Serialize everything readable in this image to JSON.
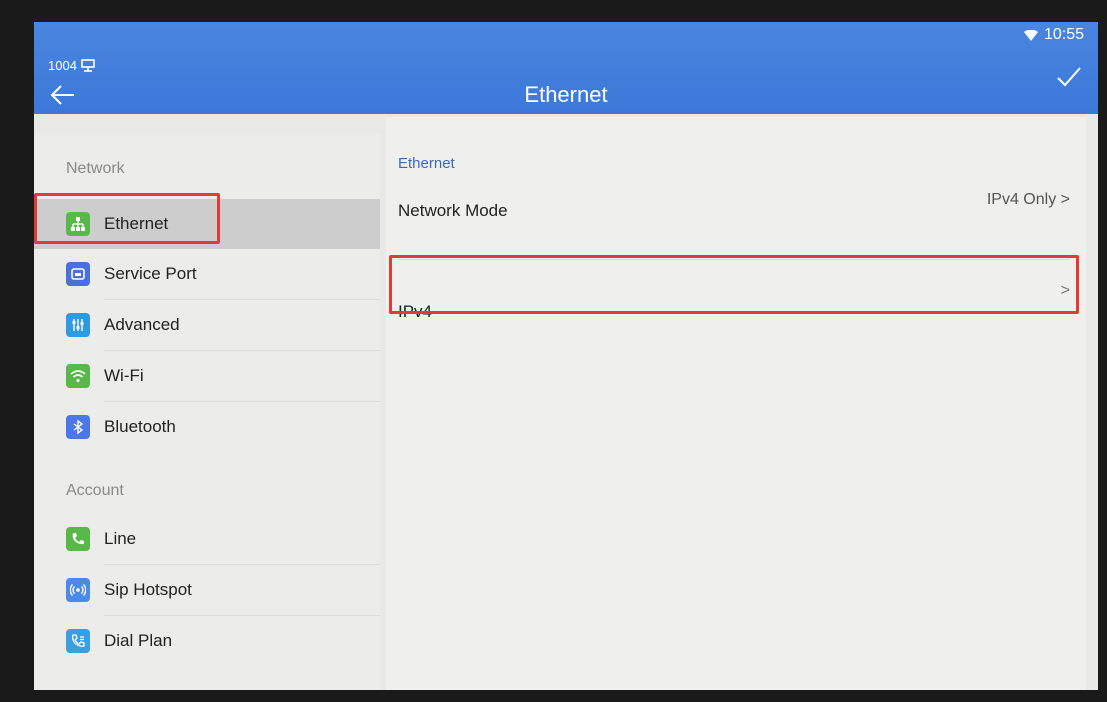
{
  "status": {
    "extension": "1004",
    "time": "10:55"
  },
  "header": {
    "title": "Ethernet"
  },
  "sidebar": {
    "sections": [
      {
        "label": "Network"
      },
      {
        "label": "Account"
      }
    ],
    "items": [
      {
        "label": "Ethernet",
        "icon": "ethernet-icon",
        "color": "#59b84a"
      },
      {
        "label": "Service Port",
        "icon": "service-port-icon",
        "color": "#4a70e0"
      },
      {
        "label": "Advanced",
        "icon": "sliders-icon",
        "color": "#2e9be0"
      },
      {
        "label": "Wi-Fi",
        "icon": "wifi-icon",
        "color": "#59b84a"
      },
      {
        "label": "Bluetooth",
        "icon": "bluetooth-icon",
        "color": "#4a78e8"
      },
      {
        "label": "Line",
        "icon": "phone-line-icon",
        "color": "#59b84a"
      },
      {
        "label": "Sip Hotspot",
        "icon": "hotspot-icon",
        "color": "#4a8ae8"
      },
      {
        "label": "Dial Plan",
        "icon": "dial-plan-icon",
        "color": "#3a9ee0"
      }
    ]
  },
  "main": {
    "heading": "Ethernet",
    "rows": [
      {
        "label": "Network Mode",
        "value": "IPv4 Only",
        "chevron": ">"
      },
      {
        "label": "IPv4",
        "chevron": ">"
      }
    ]
  }
}
